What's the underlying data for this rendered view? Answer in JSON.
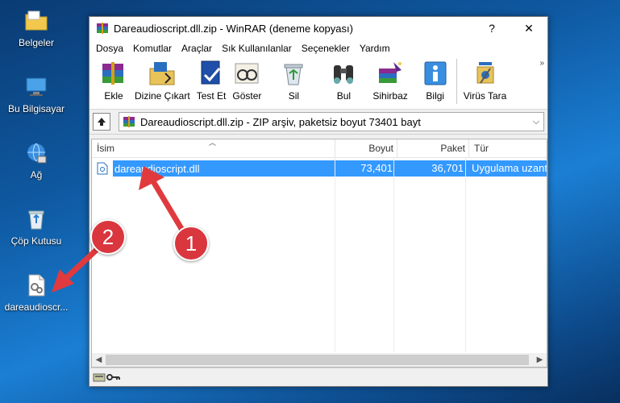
{
  "desktop": {
    "icons": [
      {
        "label": "Belgeler"
      },
      {
        "label": "Bu Bilgisayar"
      },
      {
        "label": "Ağ"
      },
      {
        "label": "Çöp Kutusu"
      },
      {
        "label": "dareaudioscr..."
      }
    ]
  },
  "window": {
    "title": "Dareaudioscript.dll.zip - WinRAR (deneme kopyası)",
    "help_btn": "?",
    "close_btn": "✕"
  },
  "menu": [
    "Dosya",
    "Komutlar",
    "Araçlar",
    "Sık Kullanılanlar",
    "Seçenekler",
    "Yardım"
  ],
  "toolbar": {
    "add": "Ekle",
    "extract": "Dizine Çıkart",
    "test": "Test Et",
    "view": "Göster",
    "delete": "Sil",
    "find": "Bul",
    "wizard": "Sihirbaz",
    "info": "Bilgi",
    "virus": "Virüs Tara",
    "more": "»"
  },
  "path": {
    "text": "Dareaudioscript.dll.zip - ZIP arşiv, paketsiz boyut 73401 bayt"
  },
  "columns": {
    "name": "İsim",
    "size": "Boyut",
    "packed": "Paket",
    "type": "Tür"
  },
  "files": [
    {
      "name": "dareaudioscript.dll",
      "size": "73,401",
      "packed": "36,701",
      "type": "Uygulama uzantısı"
    }
  ],
  "annotations": {
    "badge1": "1",
    "badge2": "2"
  },
  "colors": {
    "selection": "#3399ff",
    "badge": "#d9363e"
  }
}
